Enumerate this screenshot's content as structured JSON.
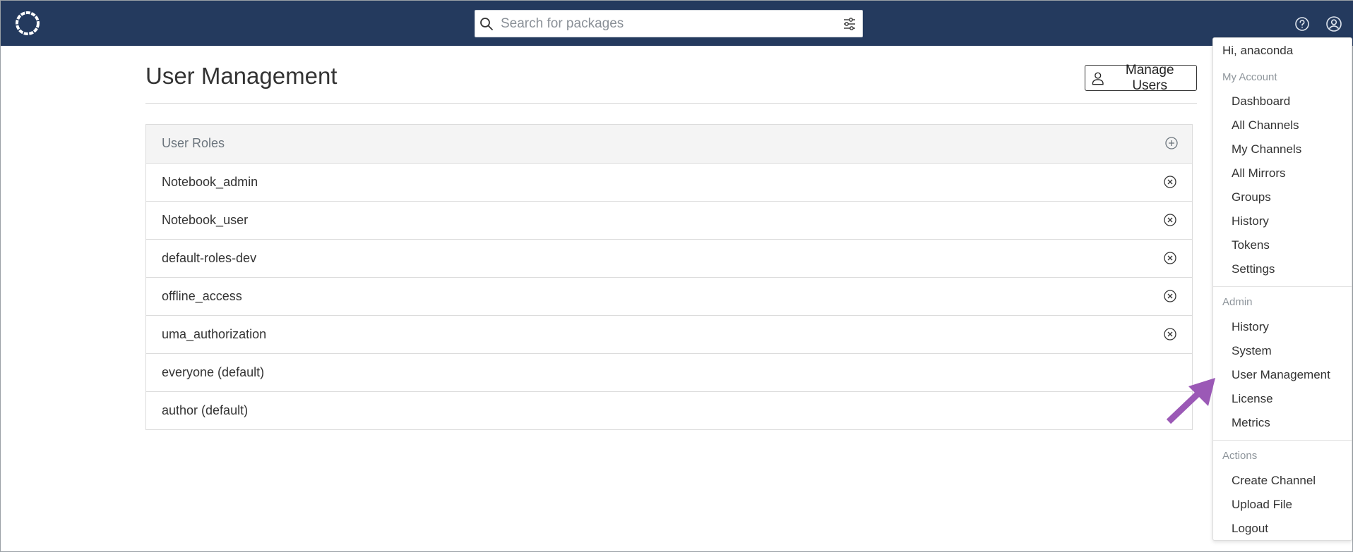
{
  "header": {
    "search_placeholder": "Search for packages"
  },
  "page": {
    "title": "User Management",
    "manage_users_label": "Manage Users"
  },
  "roles": {
    "header_label": "User Roles",
    "items": [
      {
        "name": "Notebook_admin",
        "removable": true
      },
      {
        "name": "Notebook_user",
        "removable": true
      },
      {
        "name": "default-roles-dev",
        "removable": true
      },
      {
        "name": "offline_access",
        "removable": true
      },
      {
        "name": "uma_authorization",
        "removable": true
      },
      {
        "name": "everyone (default)",
        "removable": false
      },
      {
        "name": "author (default)",
        "removable": false
      }
    ]
  },
  "menu": {
    "greeting": "Hi, anaconda",
    "my_account": {
      "title": "My Account",
      "items": [
        "Dashboard",
        "All Channels",
        "My Channels",
        "All Mirrors",
        "Groups",
        "History",
        "Tokens",
        "Settings"
      ]
    },
    "admin": {
      "title": "Admin",
      "items": [
        "History",
        "System",
        "User Management",
        "License",
        "Metrics"
      ]
    },
    "actions": {
      "title": "Actions",
      "items": [
        "Create Channel",
        "Upload File",
        "Logout"
      ]
    }
  },
  "icons": {
    "logo": "anaconda-ring-logo",
    "search": "search-icon",
    "filter": "sliders-icon",
    "help": "question-circle-icon",
    "user": "user-circle-icon",
    "add": "plus-circle-icon",
    "remove": "x-circle-icon",
    "annotation": "arrow-icon"
  },
  "colors": {
    "topbar": "#243a5e",
    "arrow": "#9b59b6",
    "section_text": "#8e959b"
  }
}
